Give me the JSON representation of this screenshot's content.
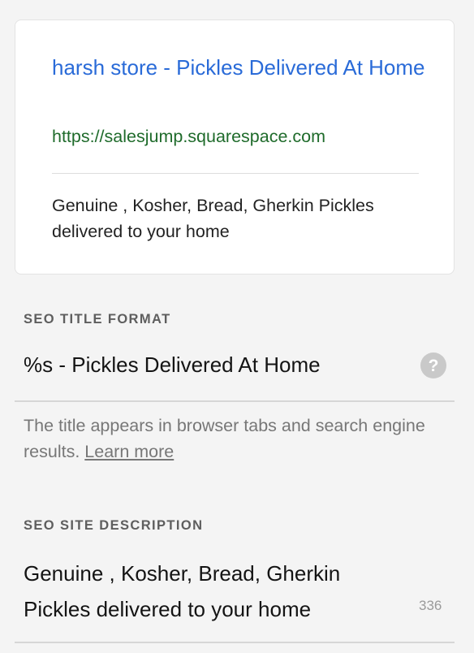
{
  "preview": {
    "title": "harsh store - Pickles Delivered At Home",
    "url": "https://salesjump.squarespace.com",
    "description": "Genuine , Kosher, Bread, Gherkin Pickles delivered to your home"
  },
  "seo_title": {
    "label": "SEO TITLE FORMAT",
    "value": "%s - Pickles Delivered At Home",
    "help_icon": "question-mark-icon",
    "help_text": "The title appears in browser tabs and search engine results.",
    "learn_more": "Learn more"
  },
  "seo_description": {
    "label": "SEO SITE DESCRIPTION",
    "value": "Genuine , Kosher, Bread, Gherkin Pickles delivered to your home",
    "char_count": "336"
  },
  "colors": {
    "link": "#2a6bd8",
    "url": "#1f6b2b",
    "background": "#f4f4f4"
  }
}
